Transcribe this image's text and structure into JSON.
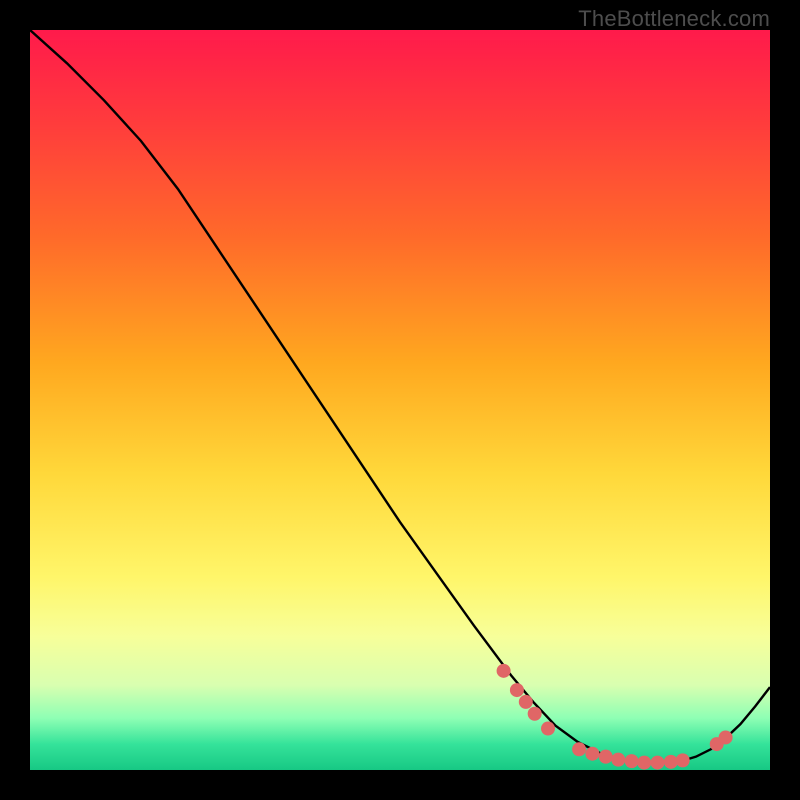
{
  "watermark": "TheBottleneck.com",
  "colors": {
    "bg": "#000000",
    "curve": "#000000",
    "marker_fill": "#e06666",
    "marker_stroke": "#b04a4a",
    "watermark": "#4d4d4d",
    "gradient_stops": [
      {
        "offset": 0.0,
        "color": "#ff1a4b"
      },
      {
        "offset": 0.12,
        "color": "#ff3a3d"
      },
      {
        "offset": 0.28,
        "color": "#ff6a2a"
      },
      {
        "offset": 0.45,
        "color": "#ffa81f"
      },
      {
        "offset": 0.6,
        "color": "#ffd83a"
      },
      {
        "offset": 0.74,
        "color": "#fff66a"
      },
      {
        "offset": 0.82,
        "color": "#f7ff9a"
      },
      {
        "offset": 0.885,
        "color": "#d9ffb0"
      },
      {
        "offset": 0.93,
        "color": "#8effb4"
      },
      {
        "offset": 0.965,
        "color": "#35e39a"
      },
      {
        "offset": 1.0,
        "color": "#17c884"
      }
    ]
  },
  "chart_data": {
    "type": "line",
    "x": [
      0.0,
      0.05,
      0.1,
      0.15,
      0.2,
      0.25,
      0.3,
      0.35,
      0.4,
      0.45,
      0.5,
      0.55,
      0.6,
      0.65,
      0.68,
      0.71,
      0.74,
      0.77,
      0.8,
      0.83,
      0.86,
      0.88,
      0.9,
      0.92,
      0.94,
      0.96,
      0.98,
      1.0
    ],
    "y": [
      1.0,
      0.955,
      0.905,
      0.85,
      0.785,
      0.71,
      0.635,
      0.56,
      0.485,
      0.41,
      0.335,
      0.265,
      0.195,
      0.128,
      0.092,
      0.06,
      0.038,
      0.023,
      0.014,
      0.01,
      0.01,
      0.012,
      0.018,
      0.028,
      0.043,
      0.062,
      0.086,
      0.112
    ],
    "title": "",
    "xlabel": "",
    "ylabel": "",
    "xlim": [
      0,
      1
    ],
    "ylim": [
      0,
      1
    ],
    "markers": {
      "x": [
        0.64,
        0.658,
        0.67,
        0.682,
        0.7,
        0.742,
        0.76,
        0.778,
        0.795,
        0.813,
        0.83,
        0.848,
        0.866,
        0.882,
        0.928,
        0.94
      ],
      "y": [
        0.134,
        0.108,
        0.092,
        0.076,
        0.056,
        0.028,
        0.022,
        0.018,
        0.014,
        0.012,
        0.01,
        0.01,
        0.011,
        0.013,
        0.035,
        0.044
      ]
    }
  }
}
